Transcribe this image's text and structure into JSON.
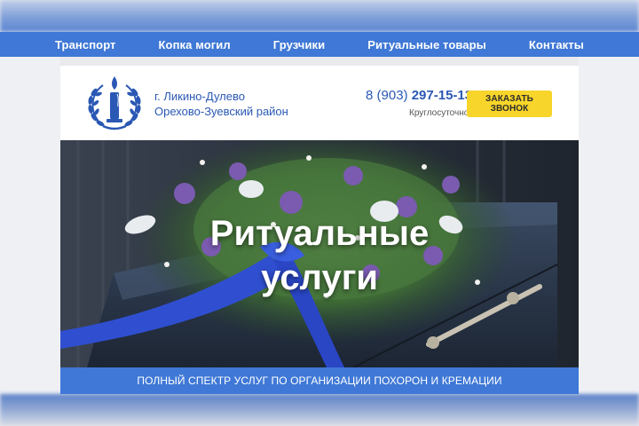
{
  "nav": {
    "items": [
      {
        "label": "Транспорт"
      },
      {
        "label": "Копка могил"
      },
      {
        "label": "Грузчики"
      },
      {
        "label": "Ритуальные товары"
      },
      {
        "label": "Контакты"
      }
    ]
  },
  "header": {
    "city_line1": "г. Ликино-Дулево",
    "city_line2": "Орехово-Зуевский район",
    "phone_prefix": "8 (903)",
    "phone_number": "297-15-13",
    "hours": "Круглосуточно",
    "callback_label": "ЗАКАЗАТЬ ЗВОНОК"
  },
  "hero": {
    "title_line1": "Ритуальные",
    "title_line2": "услуги"
  },
  "tagline": "ПОЛНЫЙ СПЕКТР УСЛУГ ПО ОРГАНИЗАЦИИ ПОХОРОН И КРЕМАЦИИ",
  "colors": {
    "brand_blue": "#3f78d6",
    "text_blue": "#2a58b4",
    "button_yellow": "#f7d52a"
  },
  "icons": {
    "logo": "candle-laurel-icon"
  }
}
